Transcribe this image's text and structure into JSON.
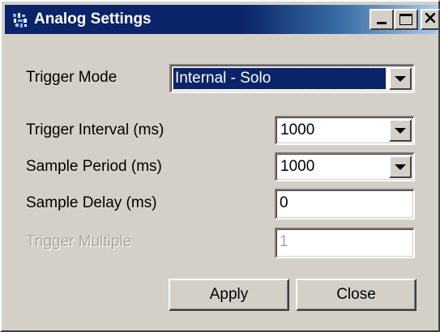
{
  "window": {
    "title": "Analog Settings",
    "controls": {
      "minimize_icon": "minimize-icon",
      "maximize_icon": "maximize-icon",
      "close_glyph": "×"
    }
  },
  "form": {
    "trigger_mode": {
      "label": "Trigger Mode",
      "value": "Internal - Solo"
    },
    "trigger_interval": {
      "label": "Trigger Interval (ms)",
      "value": "1000"
    },
    "sample_period": {
      "label": "Sample Period (ms)",
      "value": "1000"
    },
    "sample_delay": {
      "label": "Sample Delay (ms)",
      "value": "0"
    },
    "trigger_multiple": {
      "label": "Trigger Multiple",
      "value": "1",
      "enabled": false
    }
  },
  "buttons": {
    "apply": "Apply",
    "close": "Close"
  },
  "colors": {
    "titlebar_start": "#0a246a",
    "titlebar_end": "#a6caf0",
    "face": "#d4d0c8",
    "selection": "#0a246a",
    "disabled_text": "#a9a69f"
  }
}
